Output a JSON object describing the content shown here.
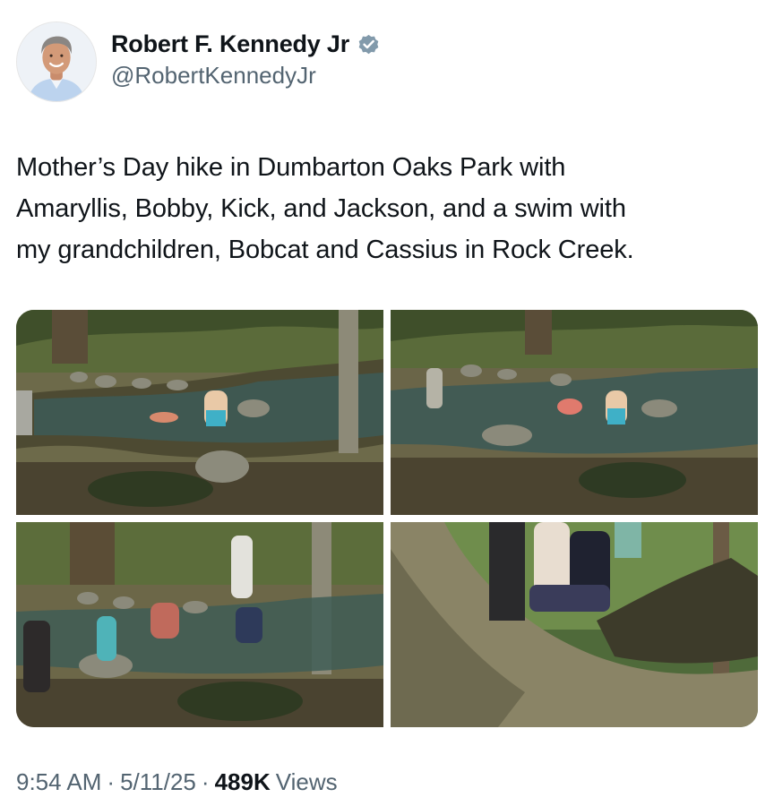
{
  "author": {
    "display_name": "Robert F. Kennedy Jr",
    "handle": "@RobertKennedyJr",
    "verified": true,
    "verified_color": "#829aab"
  },
  "tweet": {
    "text_lines": [
      "Mother’s Day hike in Dumbarton Oaks Park with",
      "Amaryllis, Bobby, Kick, and Jackson, and a swim with",
      "my grandchildren, Bobcat and Cassius in Rock Creek."
    ]
  },
  "media": {
    "photo_count": 4,
    "photos": [
      {
        "icon": "creek-photo"
      },
      {
        "icon": "creek-photo"
      },
      {
        "icon": "creek-group-photo"
      },
      {
        "icon": "fallen-tree-photo"
      }
    ]
  },
  "meta": {
    "time": "9:54 AM",
    "separator": "·",
    "date": "5/11/25",
    "views_count": "489K",
    "views_label": "Views"
  },
  "colors": {
    "text_primary": "#0f1419",
    "text_secondary": "#536471"
  }
}
